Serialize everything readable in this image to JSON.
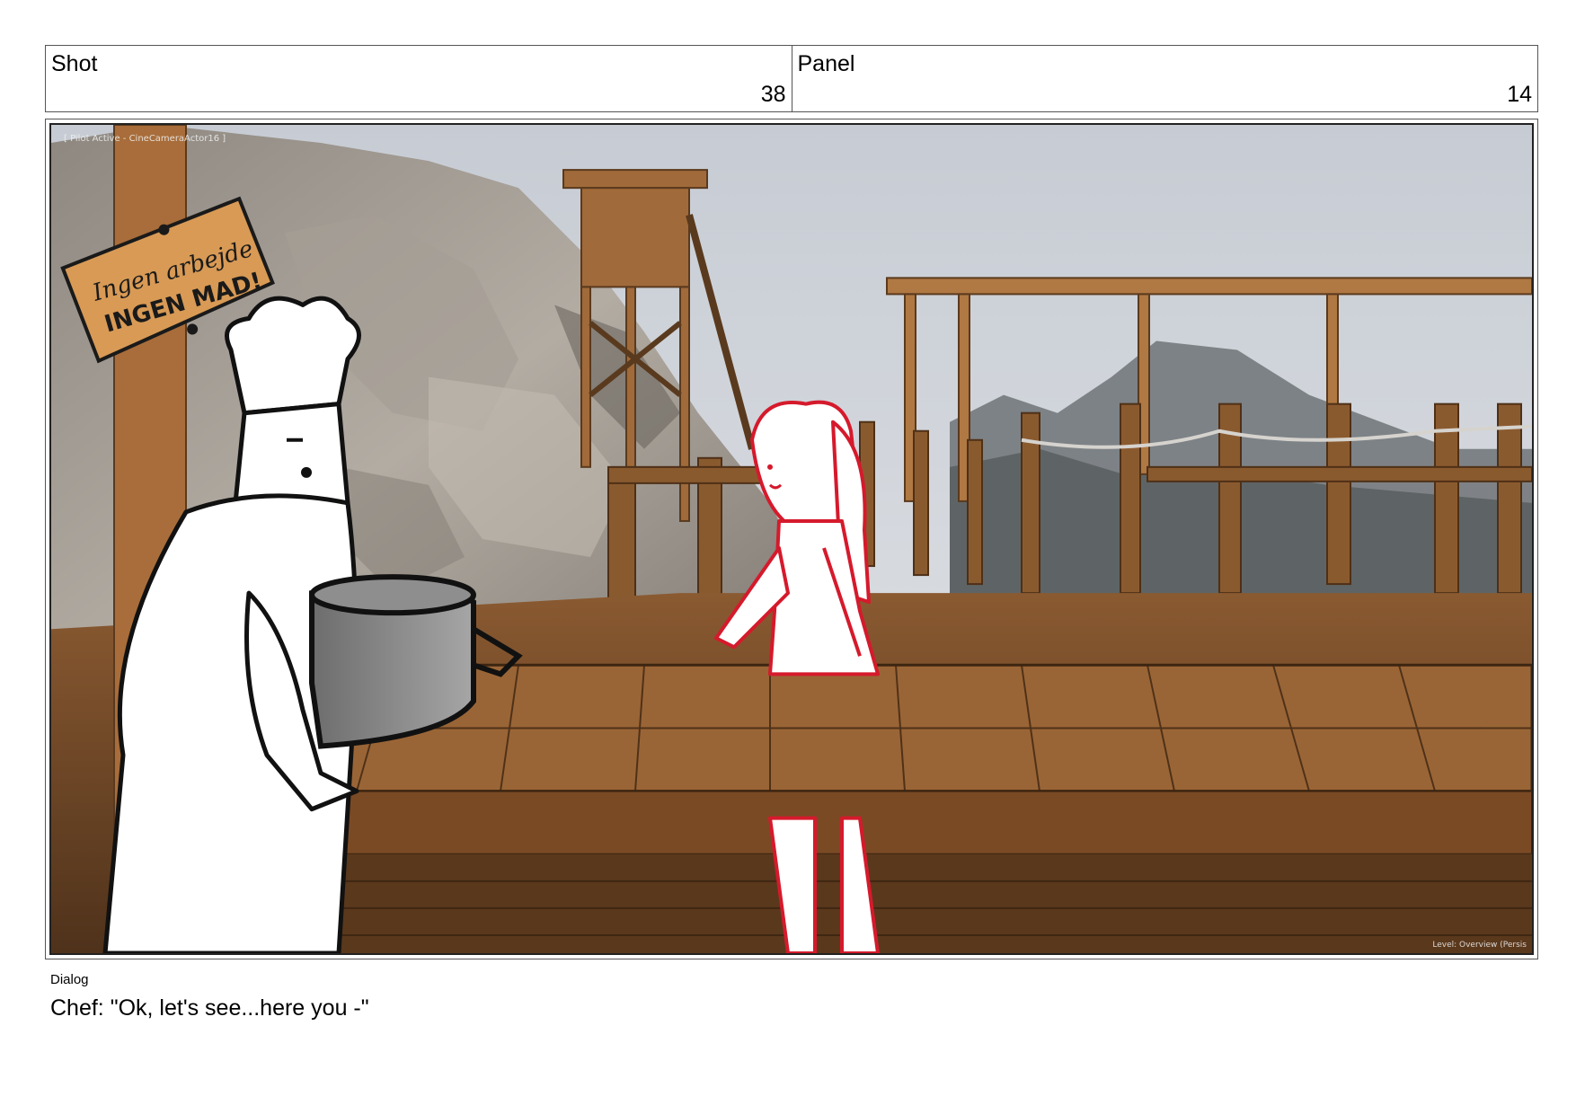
{
  "header": {
    "shot_label": "Shot",
    "shot_number": "38",
    "panel_label": "Panel",
    "panel_number": "14"
  },
  "viewport": {
    "camera_label": "[ Pilot Active - CineCameraActor16 ]",
    "level_label": "Level: Overview (Persis",
    "sign_text_line1": "Ingen arbejde",
    "sign_text_line2": "INGEN MAD!"
  },
  "dialog": {
    "label": "Dialog",
    "text": "Chef: \"Ok, let's see...here you -\""
  }
}
